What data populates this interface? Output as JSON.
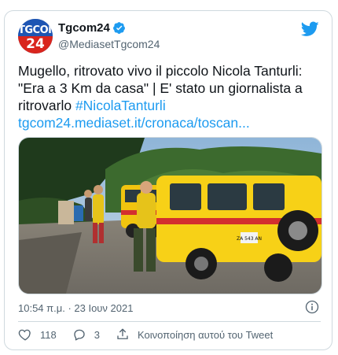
{
  "account": {
    "display_name": "Tgcom24",
    "handle": "@MediasetTgcom24",
    "avatar_text_top": "TGCOM",
    "avatar_text_bottom": "24"
  },
  "tweet": {
    "text_plain": "Mugello, ritrovato vivo il piccolo Nicola Tanturli: \"Era a 3 Km da casa\" | E' stato un giornalista a ritrovarlo  ",
    "hashtag": "#NicolaTanturli",
    "url": "tgcom24.mediaset.it/cronaca/toscan..."
  },
  "media": {
    "description_icon": "photo-rescue-team",
    "vehicle_plate": "ZA 543 AN"
  },
  "meta": {
    "timestamp": "10:54 π.μ. · 23 Ιουν 2021"
  },
  "actions": {
    "like_count": "118",
    "reply_count": "3",
    "share_label": "Κοινοποίηση αυτού του Tweet"
  },
  "colors": {
    "link": "#1d9bf0",
    "verified": "#1d9bf0",
    "secondary_text": "#536471",
    "border": "#cfd9de"
  }
}
